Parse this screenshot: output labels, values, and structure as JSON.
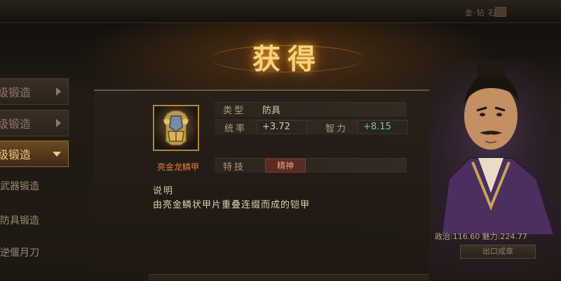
{
  "topbar": {
    "right_text": "金·钻 石"
  },
  "menu": {
    "items": [
      {
        "label": "级锻造",
        "state": "collapsed"
      },
      {
        "label": "级锻造",
        "state": "collapsed"
      },
      {
        "label": "级锻造",
        "state": "expanded"
      }
    ],
    "sub_items": [
      "武器锻造",
      "防具锻造",
      "逆偃月刀"
    ]
  },
  "dialog": {
    "title": "获得",
    "item": {
      "name": "亮金龙鳞甲",
      "type_label": "类型",
      "type_value": "防具",
      "stats": [
        {
          "label": "统率",
          "value": "+3.72"
        },
        {
          "label": "智力",
          "value": "+8.15"
        }
      ],
      "skill_label": "特技",
      "skill_value": "精神",
      "desc_title": "说明",
      "desc_text": "由亮金鳞状甲片重叠连缀而成的铠甲"
    }
  },
  "character": {
    "stats_text": "政治:116.60 魅力:224.77",
    "button_label": "出口成章"
  },
  "colors": {
    "title_gold": "#f6d27a",
    "item_name": "#e4803a",
    "stat_positive": "#7cc49a",
    "menu_active": "#6b4a22"
  }
}
